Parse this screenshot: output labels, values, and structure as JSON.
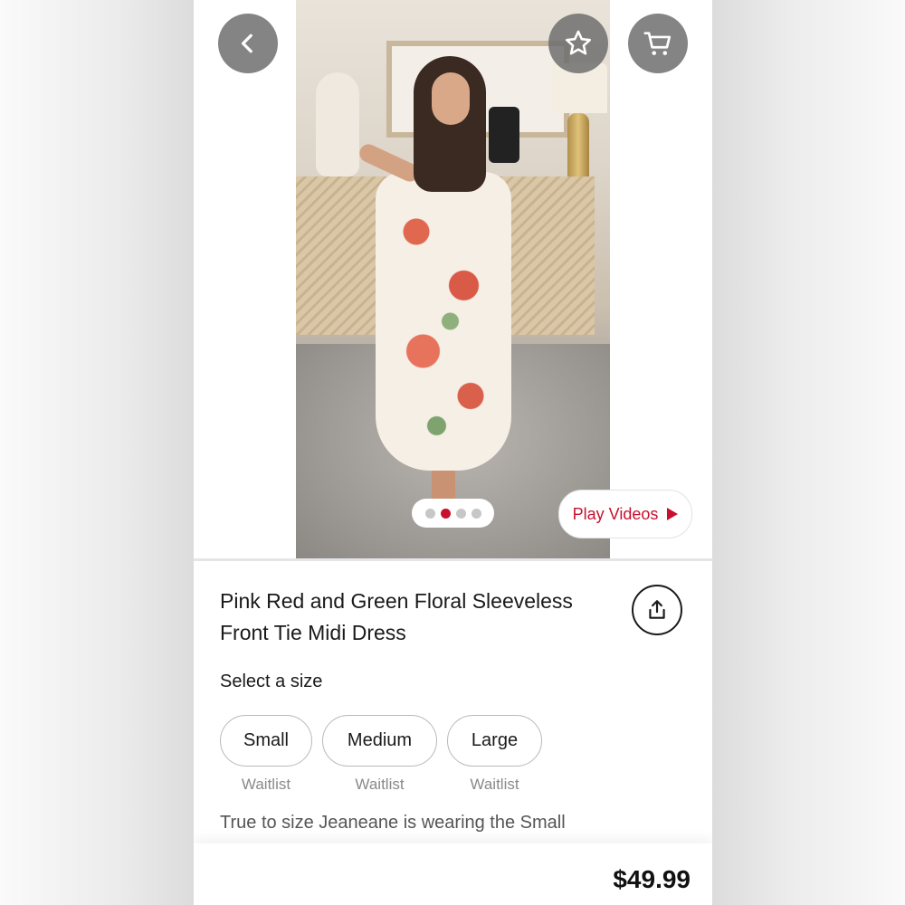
{
  "product": {
    "title": "Pink Red and Green Floral Sleeveless Front Tie Midi Dress",
    "description": "True to size Jeaneane is wearing the Small",
    "price": "$49.99"
  },
  "gallery": {
    "image_count": 4,
    "active_index": 1,
    "play_videos_label": "Play Videos"
  },
  "size_section": {
    "heading": "Select a size",
    "options": [
      {
        "label": "Small",
        "status": "Waitlist"
      },
      {
        "label": "Medium",
        "status": "Waitlist"
      },
      {
        "label": "Large",
        "status": "Waitlist"
      }
    ]
  },
  "icons": {
    "back": "chevron-left-icon",
    "favorite": "star-icon",
    "cart": "cart-icon",
    "share": "share-icon",
    "play": "play-icon"
  },
  "colors": {
    "accent": "#c8102e",
    "overlay_button": "#6e6e6e"
  }
}
